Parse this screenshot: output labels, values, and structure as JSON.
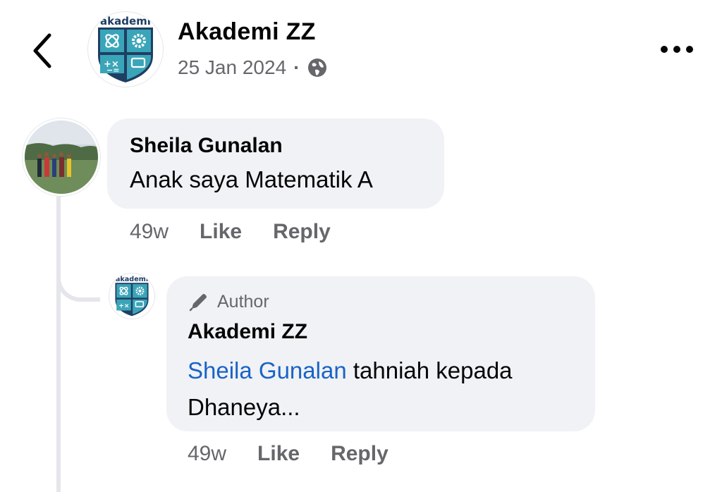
{
  "header": {
    "page_name": "Akademi ZZ",
    "date": "25 Jan 2024",
    "separator": "·",
    "audience_icon": "globe-icon",
    "logo_text": "akademi",
    "back_icon": "chevron-left-icon",
    "more_icon": "more-horizontal-icon"
  },
  "comment": {
    "author": "Sheila Gunalan",
    "text": "Anak saya Matematik A",
    "time": "49w",
    "like_label": "Like",
    "reply_label": "Reply"
  },
  "reply": {
    "badge": "Author",
    "badge_icon": "pen-icon",
    "author": "Akademi ZZ",
    "mention": "Sheila Gunalan",
    "text": " tahniah kepada Dhaneya...",
    "time": "49w",
    "like_label": "Like",
    "reply_label": "Reply"
  },
  "colors": {
    "bubble": "#f0f2f5",
    "secondary_text": "#65676b",
    "mention": "#1a63c6",
    "logo_teal": "#3aa5b8",
    "logo_navy": "#1f3e63"
  }
}
